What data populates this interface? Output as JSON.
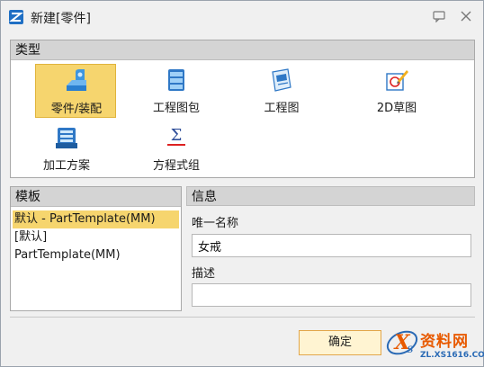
{
  "window": {
    "title": "新建[零件]",
    "help_icon": "help-icon",
    "close_icon": "close-icon"
  },
  "type_section": {
    "header": "类型",
    "items": [
      {
        "label": "零件/装配",
        "icon": "part-assembly-icon",
        "selected": true
      },
      {
        "label": "工程图包",
        "icon": "drawing-package-icon",
        "selected": false
      },
      {
        "label": "工程图",
        "icon": "drawing-icon",
        "selected": false
      },
      {
        "label": "2D草图",
        "icon": "sketch-2d-icon",
        "selected": false
      },
      {
        "label": "加工方案",
        "icon": "machining-plan-icon",
        "selected": false
      },
      {
        "label": "方程式组",
        "icon": "equation-set-icon",
        "selected": false
      }
    ]
  },
  "template_section": {
    "header": "模板",
    "items": [
      {
        "label": "默认 - PartTemplate(MM)",
        "selected": true
      },
      {
        "label": "[默认]",
        "selected": false
      },
      {
        "label": "PartTemplate(MM)",
        "selected": false
      }
    ]
  },
  "info_section": {
    "header": "信息",
    "name_label": "唯一名称",
    "name_value": "女戒",
    "desc_label": "描述",
    "desc_value": ""
  },
  "footer": {
    "ok_label": "确定"
  },
  "watermark": {
    "title": "资料网",
    "url": "ZL.XS1616.COM"
  },
  "colors": {
    "selection": "#f6d56e",
    "header_bg": "#d4d4d4",
    "ok_button_bg": "#fff4d2",
    "ok_button_border": "#e2a64a"
  }
}
